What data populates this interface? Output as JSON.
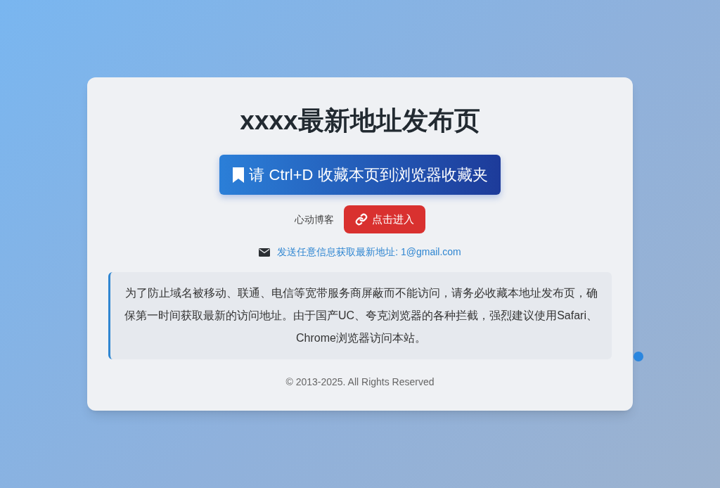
{
  "title": "xxxx最新地址发布页",
  "bookmark_banner": "请 Ctrl+D 收藏本页到浏览器收藏夹",
  "site": {
    "name": "心动博客",
    "button": "点击进入"
  },
  "contact": "发送任意信息获取最新地址: 1@gmail.com",
  "notice": "为了防止域名被移动、联通、电信等宽带服务商屏蔽而不能访问，请务必收藏本地址发布页，确保第一时间获取最新的访问地址。由于国产UC、夸克浏览器的各种拦截，强烈建议使用Safari、Chrome浏览器访问本站。",
  "footer": "© 2013-2025. All Rights Reserved"
}
